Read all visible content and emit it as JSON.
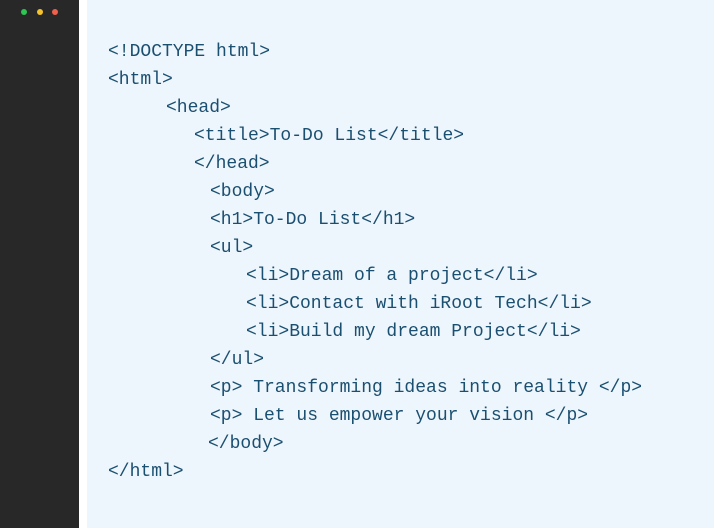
{
  "window": {
    "colors": {
      "sidebar_bg": "#282828",
      "editor_bg": "#eef6fd",
      "code_text": "#1b4f70",
      "dot_green": "#2dc653",
      "dot_yellow": "#f4c22b",
      "dot_red": "#f0604d"
    },
    "controls": [
      "green-dot",
      "yellow-dot",
      "red-dot"
    ]
  },
  "code": {
    "lines": [
      "<!DOCTYPE html>",
      "<html>",
      "<head>",
      "<title>To-Do List</title>",
      "</head>",
      "<body>",
      "<h1>To-Do List</h1>",
      "<ul>",
      "<li>Dream of a project</li>",
      "<li>Contact with iRoot Tech</li>",
      "<li>Build my dream Project</li>",
      "</ul>",
      "<p> Transforming ideas into reality </p>",
      "<p> Let us empower your vision </p>",
      "</body>",
      "</html>"
    ]
  }
}
